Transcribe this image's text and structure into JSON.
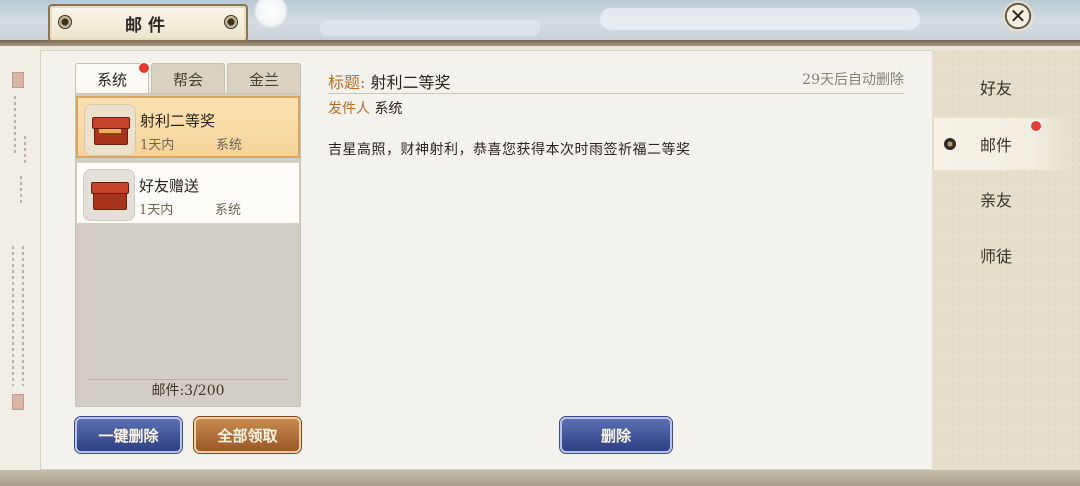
{
  "window": {
    "title": "邮件",
    "close_symbol": "✕"
  },
  "tabs": [
    {
      "label": "系统",
      "active": true,
      "has_badge": true
    },
    {
      "label": "帮会",
      "active": false,
      "has_badge": false
    },
    {
      "label": "金兰",
      "active": false,
      "has_badge": false
    }
  ],
  "mail_list": {
    "items": [
      {
        "name": "射利二等奖",
        "time": "1天内",
        "sender": "系统",
        "selected": true,
        "icon": "gift-box-icon"
      },
      {
        "name": "好友赠送",
        "time": "1天内",
        "sender": "系统",
        "selected": false,
        "icon": "red-chest-icon"
      }
    ],
    "count_label": "邮件:3/200"
  },
  "buttons": {
    "delete_all": "一键删除",
    "claim_all": "全部领取",
    "delete": "删除"
  },
  "detail": {
    "title_label": "标题:",
    "title_value": "射利二等奖",
    "expire": "29天后自动删除",
    "sender_label": "发件人",
    "sender_value": "系统",
    "body": "吉星高照，财神射利，恭喜您获得本次时雨签祈福二等奖"
  },
  "side_nav": [
    {
      "label": "好友",
      "active": false,
      "has_badge": false
    },
    {
      "label": "邮件",
      "active": true,
      "has_badge": true
    },
    {
      "label": "亲友",
      "active": false,
      "has_badge": false
    },
    {
      "label": "师徒",
      "active": false,
      "has_badge": false
    }
  ],
  "colors": {
    "badge": "#e43b32",
    "accent_label": "#b07034",
    "selected_item": "#f6d49a",
    "blue_button": "#2e3f82",
    "orange_button": "#9a5828"
  }
}
